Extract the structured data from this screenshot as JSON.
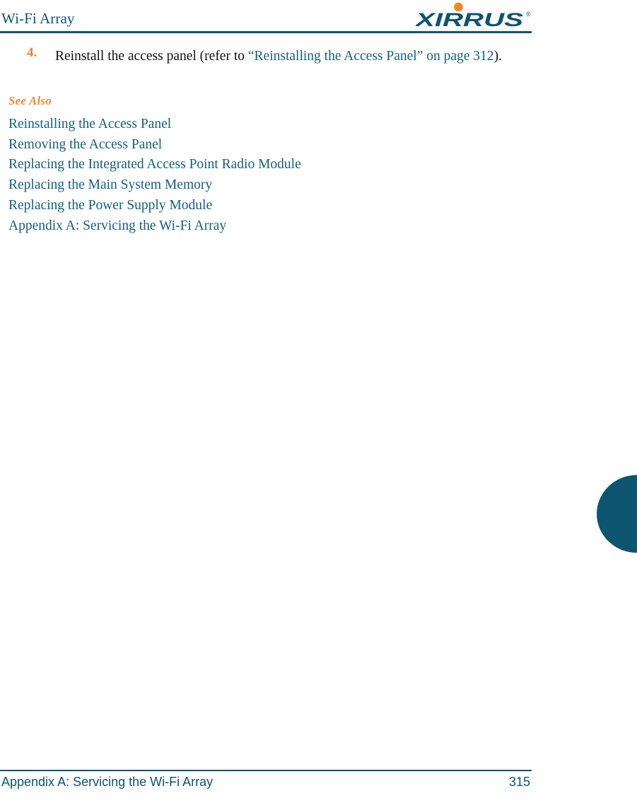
{
  "header": {
    "title": "Wi-Fi Array",
    "logo": {
      "name": "xirrus-logo",
      "wordmark": "XIRRUS",
      "trademark": "®",
      "wordmark_color": "#0d5571",
      "dot_color": "#f18a21"
    },
    "rule_color": "#0d5571"
  },
  "colors": {
    "teal": "#0d5571",
    "link_teal": "#14607e",
    "orange": "#e8813a",
    "heading_orange": "#ef8b33",
    "body_black": "#111111"
  },
  "main": {
    "step": {
      "number": "4.",
      "text_before": "Reinstall the access panel (refer to ",
      "xref_quote": "“Reinstalling the Access Panel” on page 312",
      "text_after": ")."
    },
    "see_also": {
      "heading": "See Also",
      "links": [
        "Reinstalling the Access Panel",
        "Removing the Access Panel",
        "Replacing the Integrated Access Point Radio Module",
        "Replacing the Main System Memory",
        "Replacing the Power Supply Module",
        "Appendix A: Servicing the Wi-Fi Array"
      ]
    }
  },
  "thumb_tab": {
    "name": "chapter-thumb-tab",
    "color": "#0d5571"
  },
  "footer": {
    "text": "Appendix A: Servicing the Wi-Fi Array",
    "page_number": "315",
    "rule_color": "#0d5571"
  }
}
